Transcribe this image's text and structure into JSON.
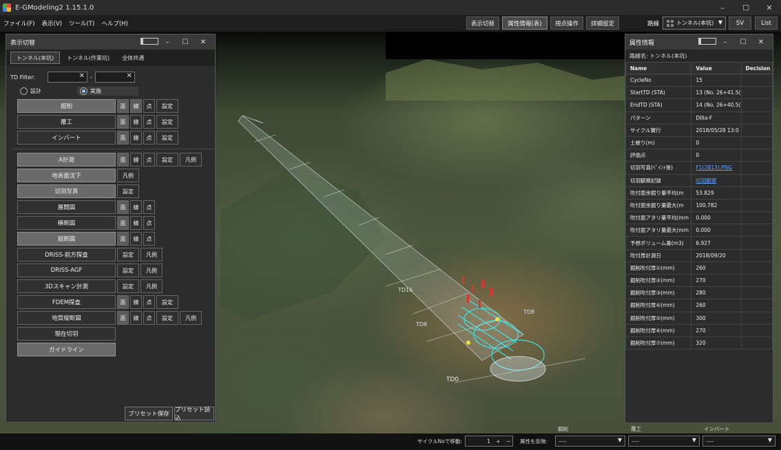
{
  "app": {
    "title": "E-GModeling2 1.15.1.0"
  },
  "window_controls": {
    "minimize": "–",
    "maximize": "☐",
    "close": "✕"
  },
  "menu": [
    "ファイル(F)",
    "表示(V)",
    "ツール(T)",
    "ヘルプ(H)"
  ],
  "toolbar": {
    "display_switch": "表示切替",
    "attribute_info": "属性情報(表)",
    "viewpoint": "視点操作",
    "detail_settings": "詳細設定",
    "route_label": "路線",
    "route_value": "トンネル(本坑)",
    "sv": "SV",
    "list": "List"
  },
  "display_panel": {
    "title": "表示切替",
    "tabs": [
      "トンネル(本坑)",
      "トンネル(作業坑)",
      "全体共通"
    ],
    "active_tab": 0,
    "td_filter_label": "TD Filter:",
    "td_filter_from": "",
    "td_filter_to": "",
    "td_filter_separator": "-",
    "radio": [
      "設計",
      "実施"
    ],
    "radio_selected": 1,
    "layers_group1": [
      {
        "name": "掘削",
        "on": true,
        "buttons": [
          {
            "t": "面",
            "on": true
          },
          {
            "t": "線",
            "on": true
          },
          {
            "t": "点",
            "on": false
          },
          {
            "t": "設定",
            "on": false
          }
        ]
      },
      {
        "name": "覆工",
        "on": false,
        "buttons": [
          {
            "t": "面",
            "on": true
          },
          {
            "t": "線",
            "on": false
          },
          {
            "t": "点",
            "on": false
          },
          {
            "t": "設定",
            "on": false
          }
        ]
      },
      {
        "name": "インバート",
        "on": false,
        "buttons": [
          {
            "t": "面",
            "on": true
          },
          {
            "t": "線",
            "on": false
          },
          {
            "t": "点",
            "on": false
          },
          {
            "t": "設定",
            "on": false
          }
        ]
      }
    ],
    "layers_group2": [
      {
        "name": "A計測",
        "on": true,
        "buttons": [
          {
            "t": "面",
            "on": true
          },
          {
            "t": "線",
            "on": false
          },
          {
            "t": "点",
            "on": false
          },
          {
            "t": "設定",
            "on": false
          },
          {
            "t": "凡例",
            "on": false
          }
        ]
      },
      {
        "name": "地表面沈下",
        "on": true,
        "buttons": [
          {
            "t": "凡例",
            "on": false
          }
        ]
      },
      {
        "name": "切羽写真",
        "on": true,
        "buttons": [
          {
            "t": "設定",
            "on": false
          }
        ]
      },
      {
        "name": "展開図",
        "on": false,
        "buttons": [
          {
            "t": "面",
            "on": true
          },
          {
            "t": "線",
            "on": false
          },
          {
            "t": "点",
            "on": false
          }
        ]
      },
      {
        "name": "横断図",
        "on": false,
        "buttons": [
          {
            "t": "面",
            "on": true
          },
          {
            "t": "線",
            "on": false
          },
          {
            "t": "点",
            "on": false
          }
        ]
      },
      {
        "name": "縦断図",
        "on": true,
        "buttons": [
          {
            "t": "面",
            "on": true
          },
          {
            "t": "線",
            "on": false
          },
          {
            "t": "点",
            "on": false
          }
        ]
      },
      {
        "name": "DRISS-前方探査",
        "on": false,
        "buttons": [
          {
            "t": "設定",
            "on": false
          },
          {
            "t": "凡例",
            "on": false
          }
        ]
      },
      {
        "name": "DRISS-AGF",
        "on": false,
        "buttons": [
          {
            "t": "設定",
            "on": false
          },
          {
            "t": "凡例",
            "on": false
          }
        ]
      },
      {
        "name": "3Dスキャン計測",
        "on": false,
        "buttons": [
          {
            "t": "設定",
            "on": false
          },
          {
            "t": "凡例",
            "on": false
          }
        ]
      },
      {
        "name": "FDEM探査",
        "on": false,
        "buttons": [
          {
            "t": "面",
            "on": true
          },
          {
            "t": "線",
            "on": false
          },
          {
            "t": "点",
            "on": false
          },
          {
            "t": "設定",
            "on": false
          }
        ]
      },
      {
        "name": "地質縦断図",
        "on": false,
        "buttons": [
          {
            "t": "面",
            "on": true
          },
          {
            "t": "線",
            "on": false
          },
          {
            "t": "点",
            "on": false
          },
          {
            "t": "設定",
            "on": false
          },
          {
            "t": "凡例",
            "on": false
          }
        ]
      },
      {
        "name": "現在切羽",
        "on": false,
        "buttons": []
      },
      {
        "name": "ガイドライン",
        "on": true,
        "buttons": []
      }
    ],
    "preset_save": "プリセット保存",
    "preset_load": "プリセット読込"
  },
  "attribute_panel": {
    "title": "属性情報",
    "route_label": "路線名: トンネル(本坑)",
    "columns": [
      "Name",
      "Value",
      "Decision"
    ],
    "rows": [
      {
        "name": "CycleNo",
        "value": "15",
        "decision": ""
      },
      {
        "name": "StartTD (STA)",
        "value": "13 (No. 26+41.5(",
        "decision": ""
      },
      {
        "name": "EndTD (STA)",
        "value": "14 (No. 26+40.5(",
        "decision": ""
      },
      {
        "name": "パターン",
        "value": "DIIIa-F",
        "decision": ""
      },
      {
        "name": "サイクル實行",
        "value": "2018/05/28 13:0",
        "decision": ""
      },
      {
        "name": "土被り(m)",
        "value": "0",
        "decision": ""
      },
      {
        "name": "評価点",
        "value": "0",
        "decision": ""
      },
      {
        "name": "切羽写真(ﾍﾟｲﾝﾄ後)",
        "value": "F1(2B13).PNG",
        "decision": "",
        "link": true
      },
      {
        "name": "切羽観察記録",
        "value": "切羽観察",
        "decision": "",
        "link": true
      },
      {
        "name": "吹付面余掘り量平均(m",
        "value": "53.829",
        "decision": ""
      },
      {
        "name": "吹付面余掘り量最大(m",
        "value": "100.782",
        "decision": ""
      },
      {
        "name": "吹付面アタリ量平均(mm",
        "value": "0.000",
        "decision": ""
      },
      {
        "name": "吹付面アタリ量最大(mm",
        "value": "0.000",
        "decision": ""
      },
      {
        "name": "予想ボリューム量(m3)",
        "value": "6.927",
        "decision": ""
      },
      {
        "name": "吹付厚計測日",
        "value": "2018/09/20",
        "decision": ""
      },
      {
        "name": "掘削吹付厚①(mm)",
        "value": "260",
        "decision": ""
      },
      {
        "name": "掘削吹付厚②(mm)",
        "value": "270",
        "decision": ""
      },
      {
        "name": "掘削吹付厚③(mm)",
        "value": "280",
        "decision": ""
      },
      {
        "name": "掘削吹付厚④(mm)",
        "value": "260",
        "decision": ""
      },
      {
        "name": "掘削吹付厚⑤(mm)",
        "value": "300",
        "decision": ""
      },
      {
        "name": "掘削吹付厚⑥(mm)",
        "value": "270",
        "decision": ""
      },
      {
        "name": "掘削吹付厚⑦(mm)",
        "value": "320",
        "decision": ""
      }
    ]
  },
  "viewport": {
    "td_labels": [
      "TD16",
      "TD8",
      "TD0",
      "TD8"
    ]
  },
  "bottom": {
    "cycle_move_label": "サイクルNoで移動:",
    "cycle_value": "1",
    "plus": "+",
    "minus": "−",
    "reflect_label": "属性を反映:",
    "categories": [
      "掘削",
      "覆工",
      "インバート"
    ],
    "selects": [
      "----",
      "----",
      "----"
    ]
  },
  "colors": {
    "accent_link": "#5aa0ff",
    "tunnel_cyan": "#3fe0e8",
    "marker_red": "#e03030"
  }
}
